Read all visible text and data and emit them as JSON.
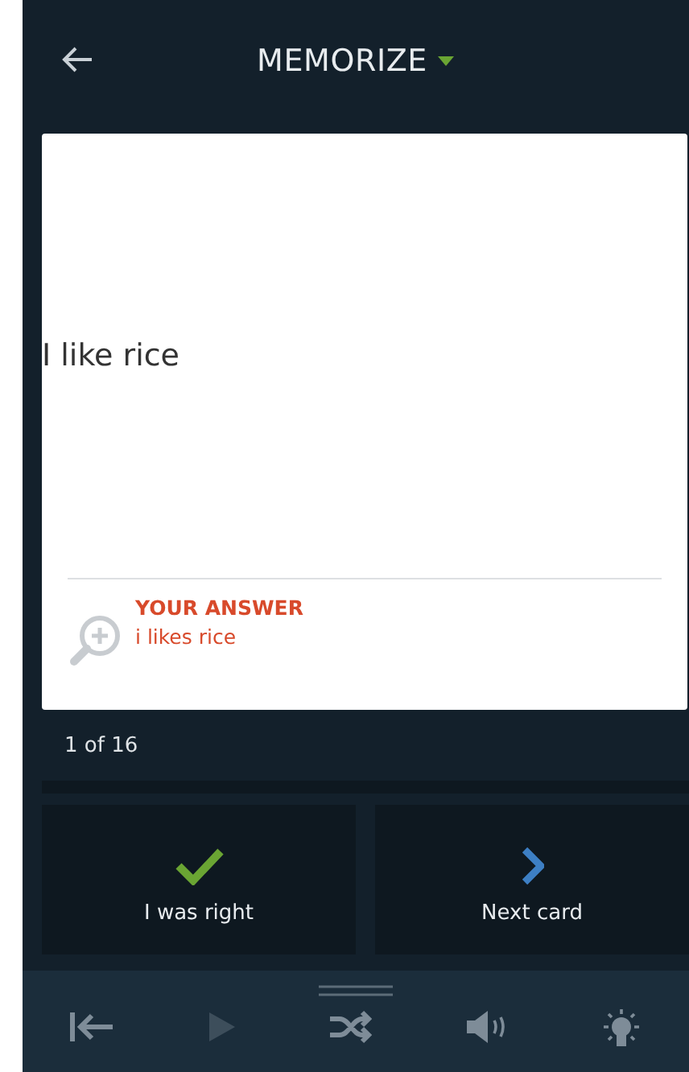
{
  "header": {
    "title": "MEMORIZE"
  },
  "card": {
    "prompt": "I like rice",
    "answer_label": "YOUR ANSWER",
    "answer": "i likes rice"
  },
  "progress": "1 of 16",
  "actions": [
    {
      "kind": "right",
      "label": "I was right"
    },
    {
      "kind": "next",
      "label": "Next card"
    }
  ],
  "toolbar": [
    {
      "kind": "restart",
      "disabled": false
    },
    {
      "kind": "play",
      "disabled": true
    },
    {
      "kind": "shuffle",
      "disabled": false
    },
    {
      "kind": "sound",
      "disabled": false
    },
    {
      "kind": "hint",
      "disabled": false
    }
  ]
}
